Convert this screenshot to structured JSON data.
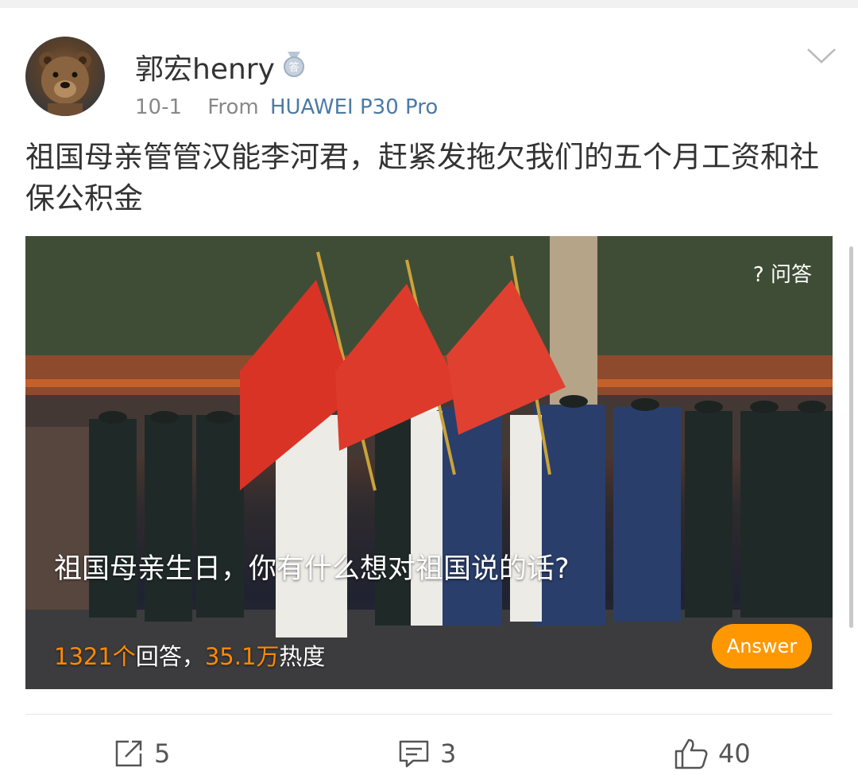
{
  "post": {
    "user": {
      "name": "郭宏henry",
      "badge_icon": "medal-badge-icon"
    },
    "time": "10-1",
    "from_label": "From",
    "device": "HUAWEI P30 Pro",
    "text": "祖国母亲管管汉能李河君，赶紧发拖欠我们的五个月工资和社保公积金"
  },
  "card": {
    "tag": "? 问答",
    "title": "祖国母亲生日，你有什么想对祖国说的话?",
    "answers_count": "1321个",
    "answers_label": "回答，",
    "heat_count": "35.1万",
    "heat_label": "热度",
    "answer_button": "Answer"
  },
  "actions": {
    "share": {
      "icon": "share-icon",
      "count": "5"
    },
    "comment": {
      "icon": "comment-icon",
      "count": "3"
    },
    "like": {
      "icon": "like-icon",
      "count": "40"
    }
  },
  "colors": {
    "link": "#4b7aa5",
    "accent_orange": "#ff8a00",
    "button_orange": "#ff9800"
  }
}
